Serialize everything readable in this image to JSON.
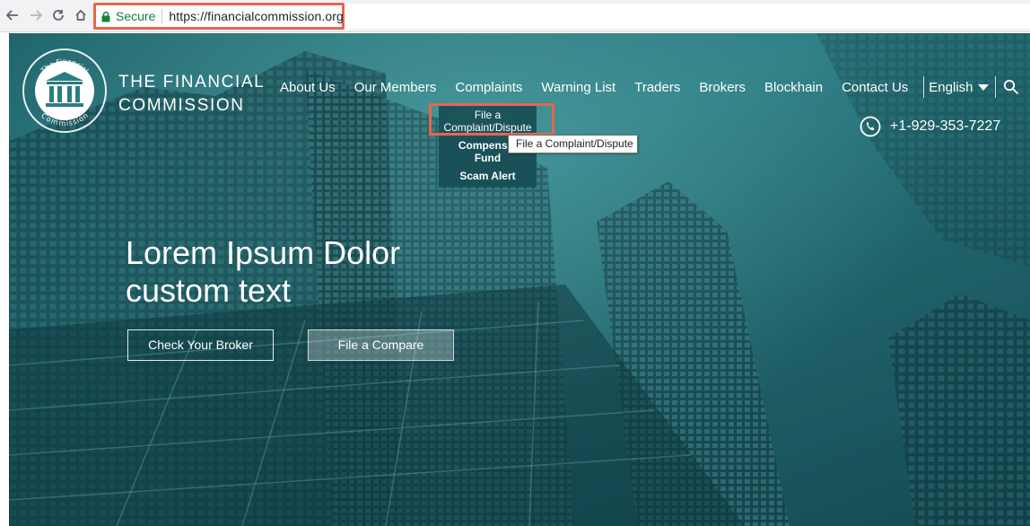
{
  "browser": {
    "back_icon": "back-arrow-icon",
    "forward_icon": "forward-arrow-icon",
    "reload_icon": "reload-icon",
    "home_icon": "home-icon",
    "secure_label": "Secure",
    "url": "https://financialcommission.org"
  },
  "brand": {
    "name_line1": "THE FINANCIAL",
    "name_line2": "COMMISSION",
    "logo_top_text": "The Financial",
    "logo_bottom_text": "Commission"
  },
  "nav": {
    "items": [
      {
        "label": "About Us"
      },
      {
        "label": "Our Members"
      },
      {
        "label": "Complaints"
      },
      {
        "label": "Warning List"
      },
      {
        "label": "Traders"
      },
      {
        "label": "Brokers"
      },
      {
        "label": "Blockhain"
      },
      {
        "label": "Contact Us"
      }
    ],
    "language": "English"
  },
  "dropdown": {
    "items": [
      {
        "line1": "File a",
        "line2": "Complaint/Dispute"
      },
      {
        "line1": "Compensat",
        "line2": "Fund"
      },
      {
        "line1": "Scam Alert",
        "line2": ""
      }
    ],
    "tooltip": "File a Complaint/Dispute"
  },
  "contact": {
    "phone": "+1-929-353-7227"
  },
  "hero": {
    "headline_line1": "Lorem Ipsum Dolor",
    "headline_line2": "custom text",
    "cta_primary": "Check Your Broker",
    "cta_secondary": "File a Compare"
  },
  "colors": {
    "highlight": "#e8664f",
    "hero_teal": "#2b7d84",
    "secure_green": "#188038"
  }
}
